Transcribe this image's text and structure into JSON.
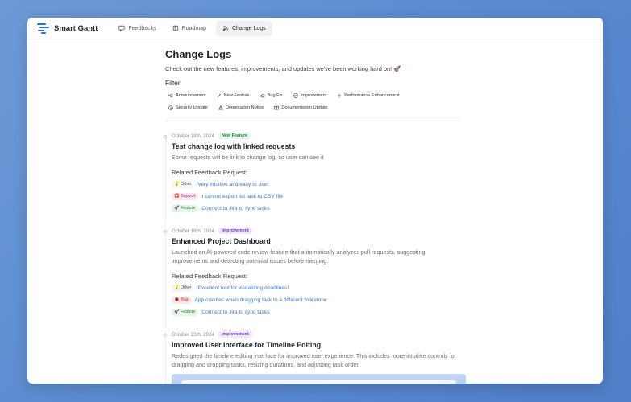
{
  "header": {
    "brand": "Smart Gantt",
    "tabs": [
      {
        "label": "Feedbacks",
        "icon": "message-square-icon"
      },
      {
        "label": "Roadmap",
        "icon": "map-icon"
      },
      {
        "label": "Change Logs",
        "icon": "rss-icon",
        "active": true
      }
    ]
  },
  "page": {
    "title": "Change Logs",
    "subtitle": "Check out the new features, improvements, and updates we've been working hard on! 🚀",
    "filter_label": "Filter",
    "filters": [
      {
        "label": "Announcement",
        "icon": "megaphone-icon"
      },
      {
        "label": "New Feature",
        "icon": "sparkles-icon"
      },
      {
        "label": "Bug Fix",
        "icon": "bug-icon"
      },
      {
        "label": "Improvement",
        "icon": "trending-up-icon"
      },
      {
        "label": "Performance Enhancement",
        "icon": "zap-icon"
      },
      {
        "label": "Security Update",
        "icon": "shield-icon"
      },
      {
        "label": "Deprecation Notice",
        "icon": "alert-triangle-icon"
      },
      {
        "label": "Documentation Update",
        "icon": "book-icon"
      }
    ]
  },
  "entries": [
    {
      "date": "October 18th, 2024",
      "tag": "New Feature",
      "title": "Test change log with linked requests",
      "description": "Some requests will be link to change log, so user can see it",
      "related_label": "Related Feedback Request:",
      "requests": [
        {
          "tag": "💡 Other",
          "type": "other",
          "text": "Very intuitive and easy to use!"
        },
        {
          "tag": "🛟 Support",
          "type": "support",
          "text": "I cannot export list task to CSV file"
        },
        {
          "tag": "🚀 Feature",
          "type": "feature",
          "text": "Connect to Jira to sync tasks"
        }
      ]
    },
    {
      "date": "October 16th, 2024",
      "tag": "Improvement",
      "title": "Enhanced Project Dashboard",
      "description": "Launched an AI-powered code review feature that automatically analyzes pull requests, suggesting improvements and detecting potential issues before merging.",
      "related_label": "Related Feedback Request:",
      "requests": [
        {
          "tag": "💡 Other",
          "type": "other",
          "text": "Excellent tool for visualizing deadlines!"
        },
        {
          "tag": "🐞 Bug",
          "type": "bug",
          "text": "App crashes when dragging task to a different milestone"
        },
        {
          "tag": "🚀 Feature",
          "type": "feature",
          "text": "Connect to Jira to sync tasks"
        }
      ]
    },
    {
      "date": "October 15th, 2024",
      "tag": "Improvement",
      "title": "Improved User Interface for Timeline Editing",
      "description": "Redesigned the timeline editing interface for improved user experience. This includes more intuitive controls for dragging and dropping tasks, resizing durations, and adjusting task order."
    }
  ]
}
